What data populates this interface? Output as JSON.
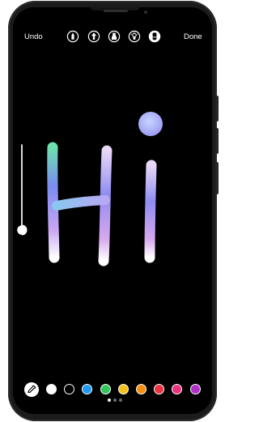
{
  "topbar": {
    "undo_label": "Undo",
    "done_label": "Done",
    "tools": [
      {
        "name": "pen-tool-icon"
      },
      {
        "name": "arrow-pen-tool-icon"
      },
      {
        "name": "marker-tool-icon"
      },
      {
        "name": "neon-tool-icon"
      },
      {
        "name": "eraser-tool-icon"
      }
    ]
  },
  "canvas": {
    "drawn_text": "Hi",
    "stroke_colors": [
      "#6fe0b0",
      "#7a8cf0",
      "#c9a6f2",
      "#e6c9f6",
      "#ffffff"
    ]
  },
  "palette": {
    "brush_icon": "eyedropper-icon",
    "colors": [
      "#ffffff",
      "#000000",
      "#1e9bf0",
      "#34c759",
      "#f5c118",
      "#f5900f",
      "#ee3340",
      "#e9337d",
      "#b22fc8"
    ],
    "page_count": 3,
    "active_page": 1
  },
  "size_slider": {
    "level": 0.92
  }
}
